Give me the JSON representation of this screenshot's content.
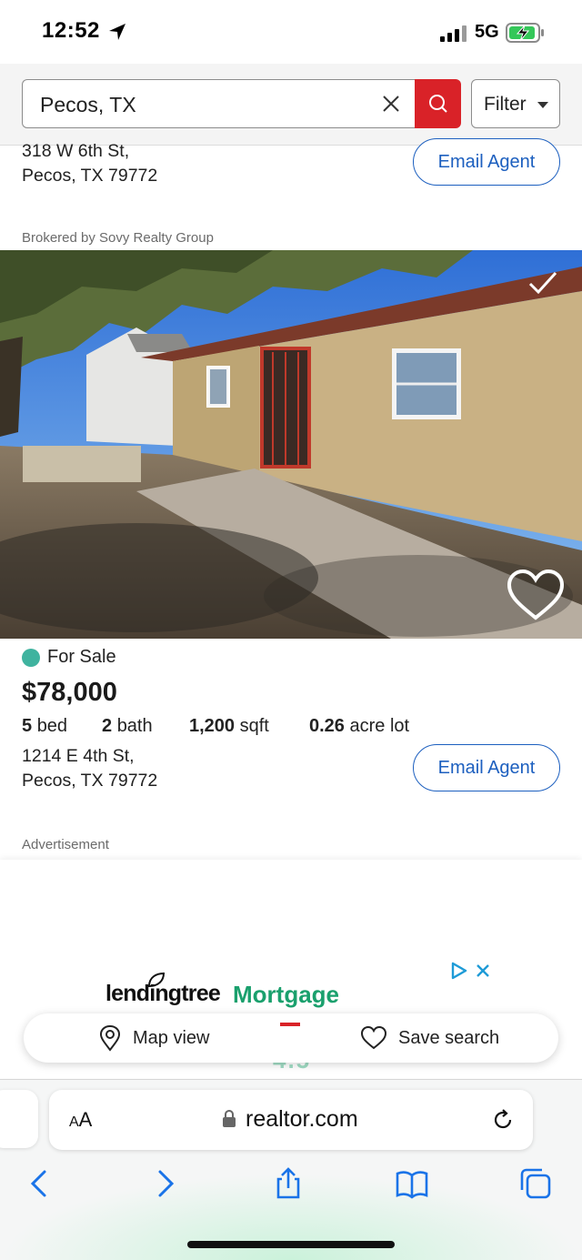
{
  "status_bar": {
    "time": "12:52",
    "network": "5G",
    "icons": [
      "location-arrow-icon",
      "signal-icon",
      "battery-charging-icon"
    ]
  },
  "search": {
    "query": "Pecos, TX",
    "filter_label": "Filter",
    "icons": [
      "clear-icon",
      "search-icon",
      "caret-down-icon"
    ],
    "accent_color": "#d92228"
  },
  "listing_previous": {
    "address_line1": "318 W 6th St,",
    "address_line2": "Pecos, TX 79772",
    "email_button": "Email Agent"
  },
  "listing": {
    "broker": "Brokered by Sovy Realty Group",
    "photo_alt": "house-photo",
    "status": "For Sale",
    "status_color": "#3fb39f",
    "price": "$78,000",
    "beds_value": "5",
    "beds_unit": "bed",
    "baths_value": "2",
    "baths_unit": "bath",
    "sqft_value": "1,200",
    "sqft_unit": "sqft",
    "lot_value": "0.26",
    "lot_unit": "acre lot",
    "address_line1": "1214 E 4th St,",
    "address_line2": "Pecos, TX 79772",
    "email_button": "Email Agent"
  },
  "advertisement": {
    "label": "Advertisement",
    "brand": "lendingtree",
    "product": "Mortgage",
    "partial_text": "4.5"
  },
  "bottom_actions": {
    "map_view": "Map view",
    "save_search": "Save search"
  },
  "browser": {
    "aa_label_small": "A",
    "aa_label_large": "A",
    "url": "realtor.com",
    "nav_icons": [
      "back-icon",
      "forward-icon",
      "share-icon",
      "bookmarks-icon",
      "tabs-icon"
    ]
  }
}
